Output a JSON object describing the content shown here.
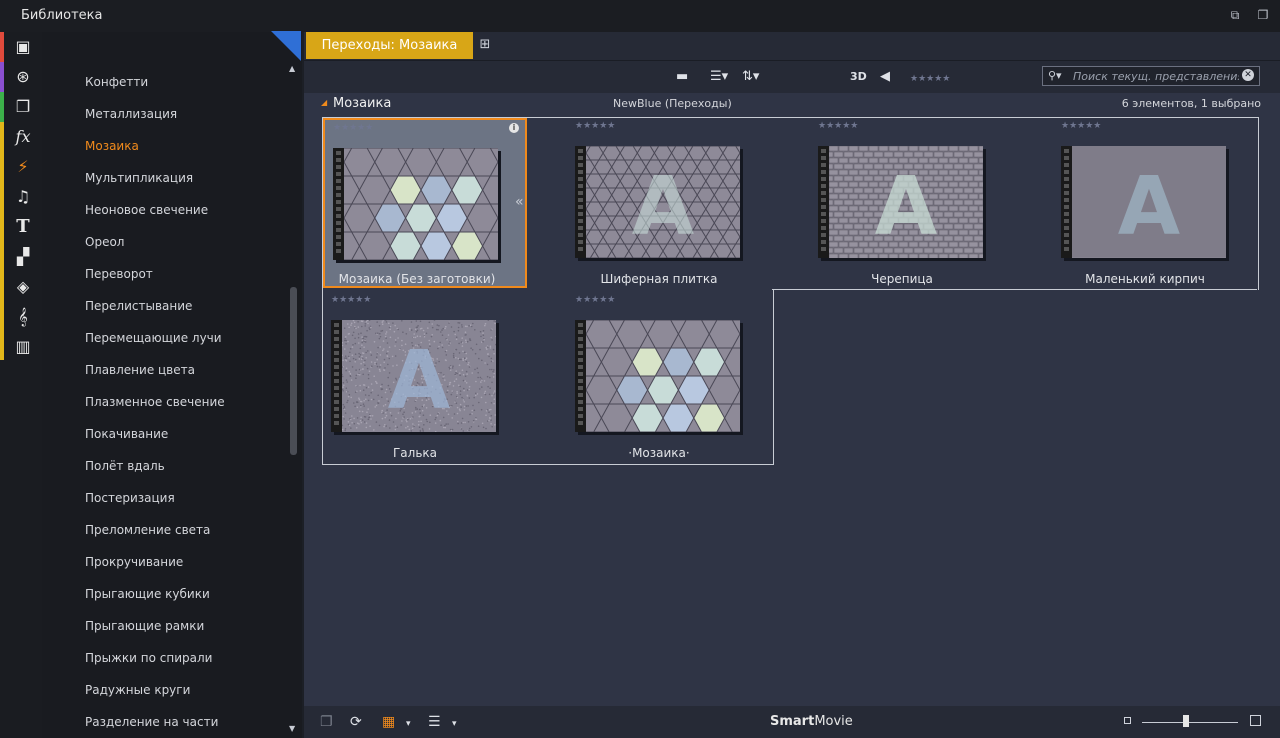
{
  "window": {
    "title": "Библиотека"
  },
  "colors": {
    "accent": "#f08a1c",
    "tab_active": "#d8a617",
    "stripe_red": "#e04a3c",
    "stripe_purple": "#8a4fd0",
    "stripe_green": "#3cb04a",
    "stripe_yellow": "#e2b71a"
  },
  "iconbar": [
    {
      "icon": "box-icon",
      "glyph": "▣"
    },
    {
      "icon": "film-reel-icon",
      "glyph": "⊛"
    },
    {
      "icon": "photos-icon",
      "glyph": "❐"
    },
    {
      "icon": "fx-icon",
      "glyph": "fx"
    },
    {
      "icon": "transition-bolt-icon",
      "glyph": "⚡"
    },
    {
      "icon": "music-note-icon",
      "glyph": "♫"
    },
    {
      "icon": "title-icon",
      "glyph": "T"
    },
    {
      "icon": "montage-icon",
      "glyph": "▞"
    },
    {
      "icon": "layers-icon",
      "glyph": "◈"
    },
    {
      "icon": "treble-clef-icon",
      "glyph": "𝄞"
    },
    {
      "icon": "piano-icon",
      "glyph": "▥"
    }
  ],
  "sidebar": {
    "items": [
      "Конфетти",
      "Металлизация",
      "Мозаика",
      "Мультипликация",
      "Неоновое свечение",
      "Ореол",
      "Переворот",
      "Перелистывание",
      "Перемещающие лучи",
      "Плавление цвета",
      "Плазменное свечение",
      "Покачивание",
      "Полёт вдаль",
      "Постеризация",
      "Преломление света",
      "Прокручивание",
      "Прыгающие кубики",
      "Прыгающие рамки",
      "Прыжки по спирали",
      "Радужные круги",
      "Разделение на части"
    ],
    "active_index": 2
  },
  "tab": {
    "label": "Переходы: Мозаика"
  },
  "toolbar": {
    "label_3d": "3D",
    "rating": "★★★★★",
    "search_placeholder": "Поиск текущ. представления"
  },
  "section": {
    "name": "Мозаика",
    "provider": "NewBlue (Переходы)",
    "count": "6 элементов, 1 выбрано"
  },
  "cards": [
    {
      "label": "Мозаика (Без заготовки)",
      "rating": "★★★★★",
      "selected": true,
      "pattern": "hex"
    },
    {
      "label": "Шиферная плитка",
      "rating": "★★★★★",
      "selected": false,
      "pattern": "slate"
    },
    {
      "label": "Черепица",
      "rating": "★★★★★",
      "selected": false,
      "pattern": "brick"
    },
    {
      "label": "Маленький кирпич",
      "rating": "★★★★★",
      "selected": false,
      "pattern": "fine"
    },
    {
      "label": "Галька",
      "rating": "★★★★★",
      "selected": false,
      "pattern": "pebble"
    },
    {
      "label": "·Мозаика·",
      "rating": "★★★★★",
      "selected": false,
      "pattern": "hex"
    }
  ],
  "statusbar": {
    "brand_bold": "Smart",
    "brand_rest": "Movie",
    "zoom_level": 0.46
  }
}
